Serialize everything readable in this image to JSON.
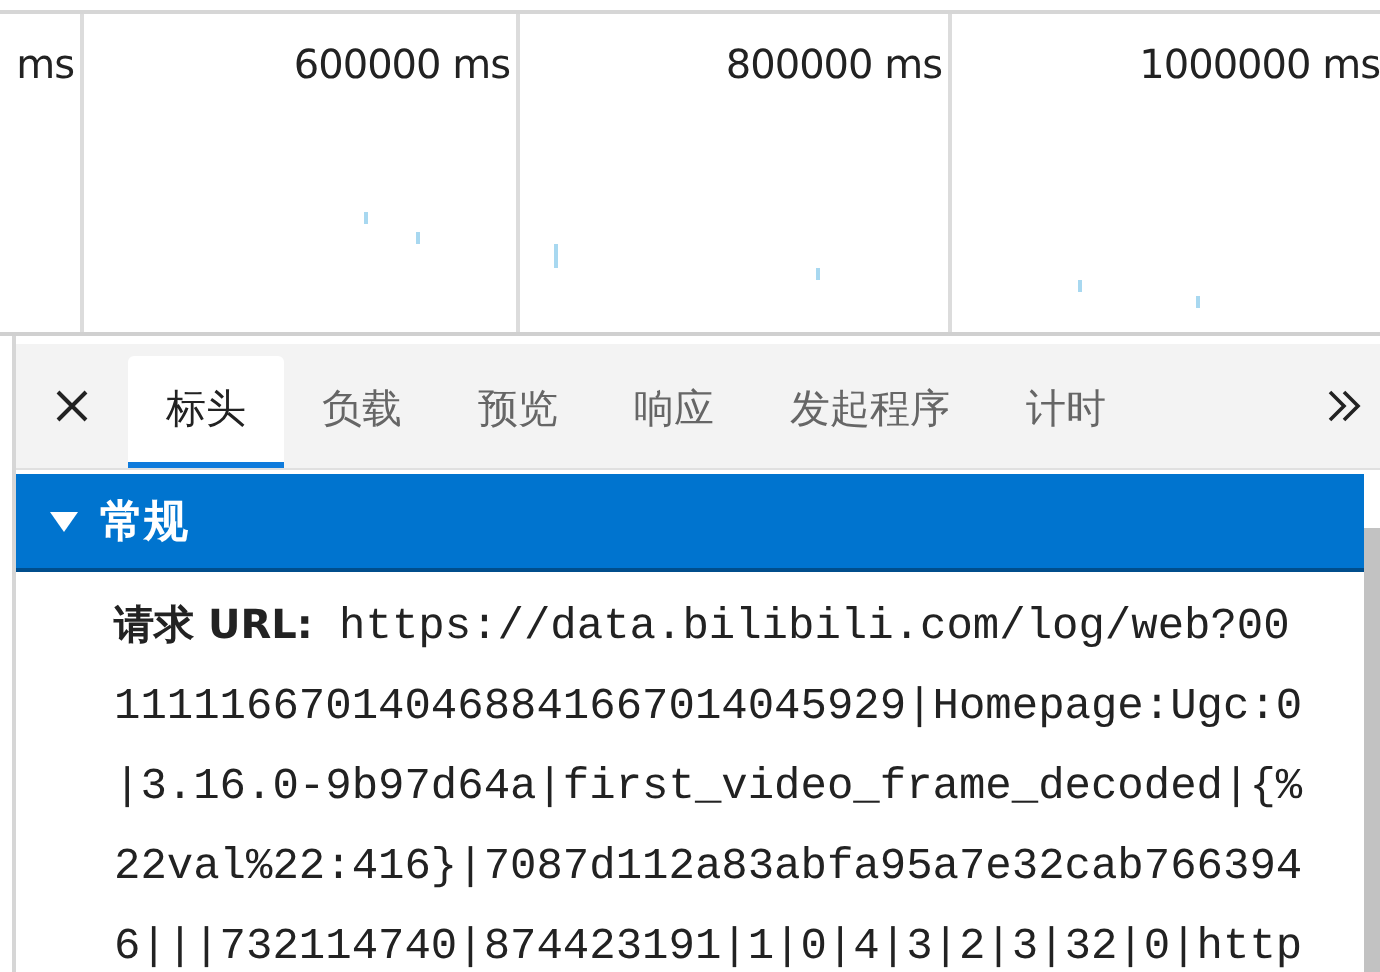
{
  "timeline": {
    "ticks": [
      "ms",
      "600000 ms",
      "800000 ms",
      "1000000 ms"
    ]
  },
  "tabs": [
    {
      "label": "标头",
      "selected": true
    },
    {
      "label": "负载",
      "selected": false
    },
    {
      "label": "预览",
      "selected": false
    },
    {
      "label": "响应",
      "selected": false
    },
    {
      "label": "发起程序",
      "selected": false
    },
    {
      "label": "计时",
      "selected": false
    }
  ],
  "section": {
    "title": "常规",
    "expanded": true,
    "rows": [
      {
        "label": "请求 URL:",
        "value": "https://data.bilibili.com/log/web?00111116670140468841667014045929|Homepage:Ugc:0|3.16.0-9b97d64a|first_video_frame_decoded|{%22val%22:416}|7087d112a83abfa95a7e32cab7663946|||732114740|874423191|1|0|4|3|2|3|32|0|http"
      }
    ]
  }
}
